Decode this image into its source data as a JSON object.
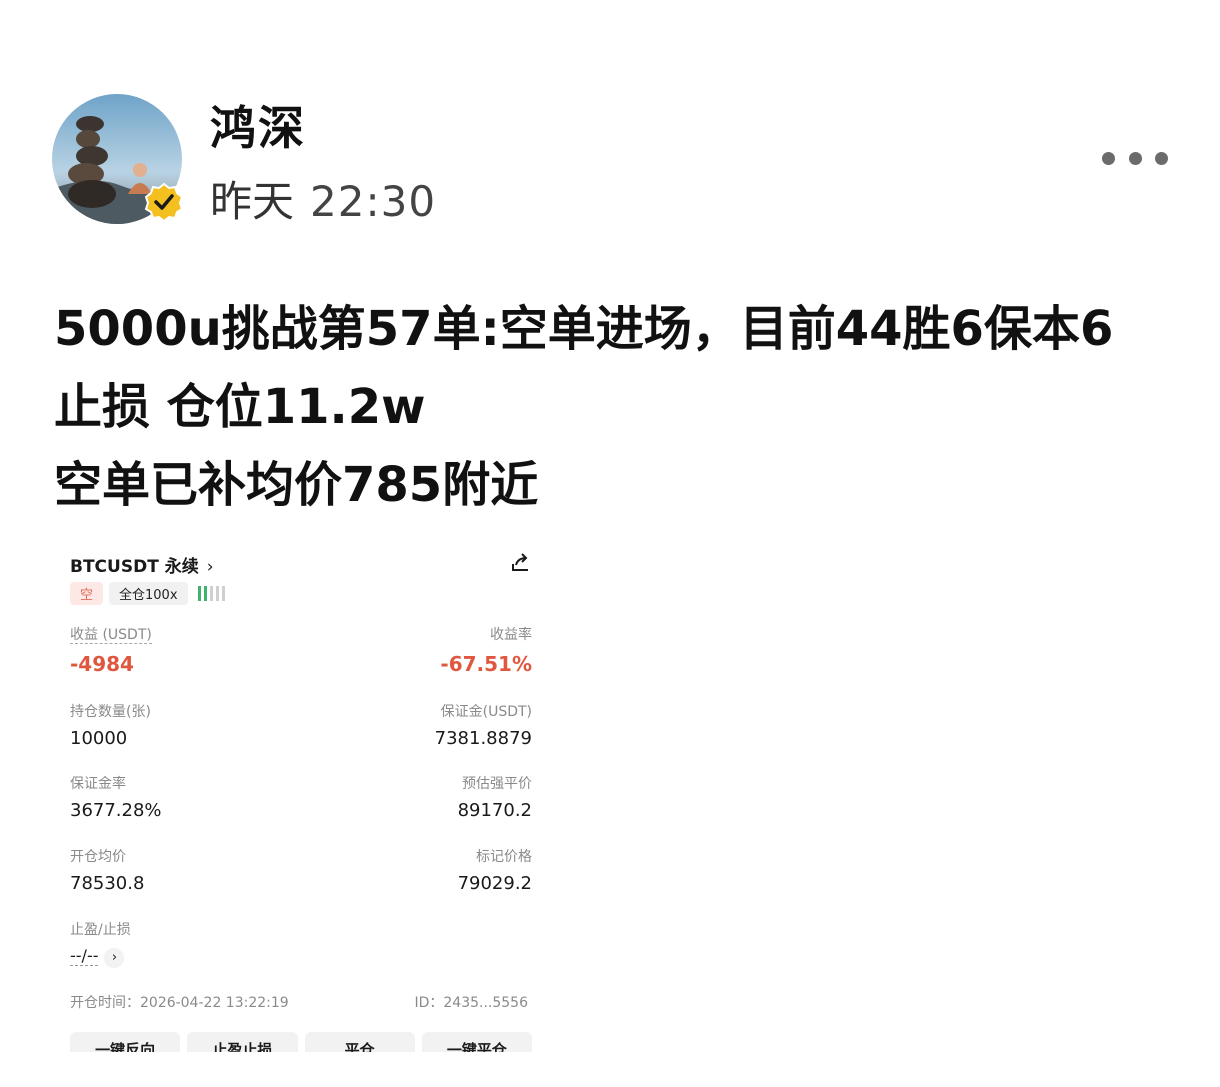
{
  "author": {
    "name": "鸿深",
    "date_label": "昨天",
    "time": "22:30",
    "verified_icon": "verified-badge-icon",
    "avatar_icon": "avatar-image"
  },
  "more_icon": "more-horizontal-icon",
  "post": {
    "lines": [
      "5000u挑战第57单:空单进场，目前44胜6保本6",
      "止损 仓位11.2w",
      "空单已补均价785附近"
    ]
  },
  "card": {
    "symbol": "BTCUSDT 永续",
    "chevron": "›",
    "share_icon": "share-icon",
    "tag_side": "空",
    "tag_margin": "全仓100x",
    "fields": {
      "pnl_label": "收益 (USDT)",
      "pnl_value": "-4984",
      "roe_label": "收益率",
      "roe_value": "-67.51%",
      "qty_label": "持仓数量(张)",
      "qty_value": "10000",
      "margin_label": "保证金(USDT)",
      "margin_value": "7381.8879",
      "margin_ratio_label": "保证金率",
      "margin_ratio_value": "3677.28%",
      "liq_label": "预估强平价",
      "liq_value": "89170.2",
      "entry_label": "开仓均价",
      "entry_value": "78530.8",
      "mark_label": "标记价格",
      "mark_value": "79029.2",
      "tpsl_label": "止盈/止损",
      "tpsl_value": "--/--"
    },
    "open_time": "开仓时间：2026-04-22 13:22:19",
    "id": "ID：2435...5556",
    "buttons": [
      "一键反向",
      "止盈止损",
      "平仓",
      "一键平仓"
    ],
    "colors": {
      "loss": "#e0573f",
      "long_bar": "#3fb26b"
    }
  }
}
